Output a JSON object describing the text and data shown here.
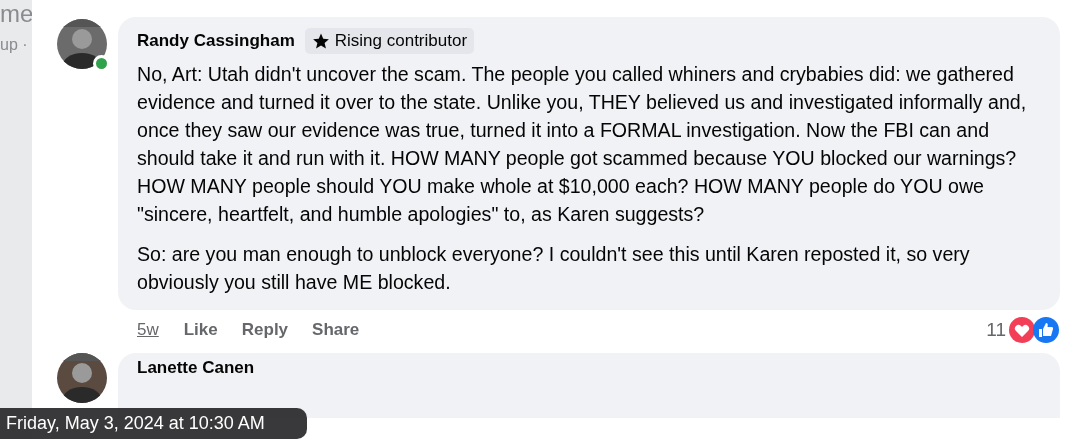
{
  "background_page": {
    "texts": [
      "me",
      "up ·"
    ]
  },
  "comment": {
    "author": "Randy Cassingham",
    "online": true,
    "badge": "Rising contributor",
    "paragraphs": [
      "No, Art: Utah didn't uncover the scam. The people you called whiners and crybabies did: we gathered evidence and turned it over to the state. Unlike you, THEY believed us and investigated informally and, once they saw our evidence was true, turned it into a FORMAL investigation. Now the FBI can and should take it and run with it. HOW MANY people got scammed because YOU blocked our warnings? HOW MANY people should YOU make whole at $10,000 each? HOW MANY people do YOU owe \"sincere, heartfelt, and humble apologies\" to, as Karen suggests?",
      "So: are you man enough to unblock everyone? I couldn't see this until Karen reposted it, so very obviously you still have ME blocked."
    ],
    "time": "5w",
    "actions": [
      "Like",
      "Reply",
      "Share"
    ],
    "reaction_count": "11"
  },
  "next_comment": {
    "author": "Lanette Canen"
  },
  "tooltip": "Friday, May 3, 2024 at 10:30 AM"
}
